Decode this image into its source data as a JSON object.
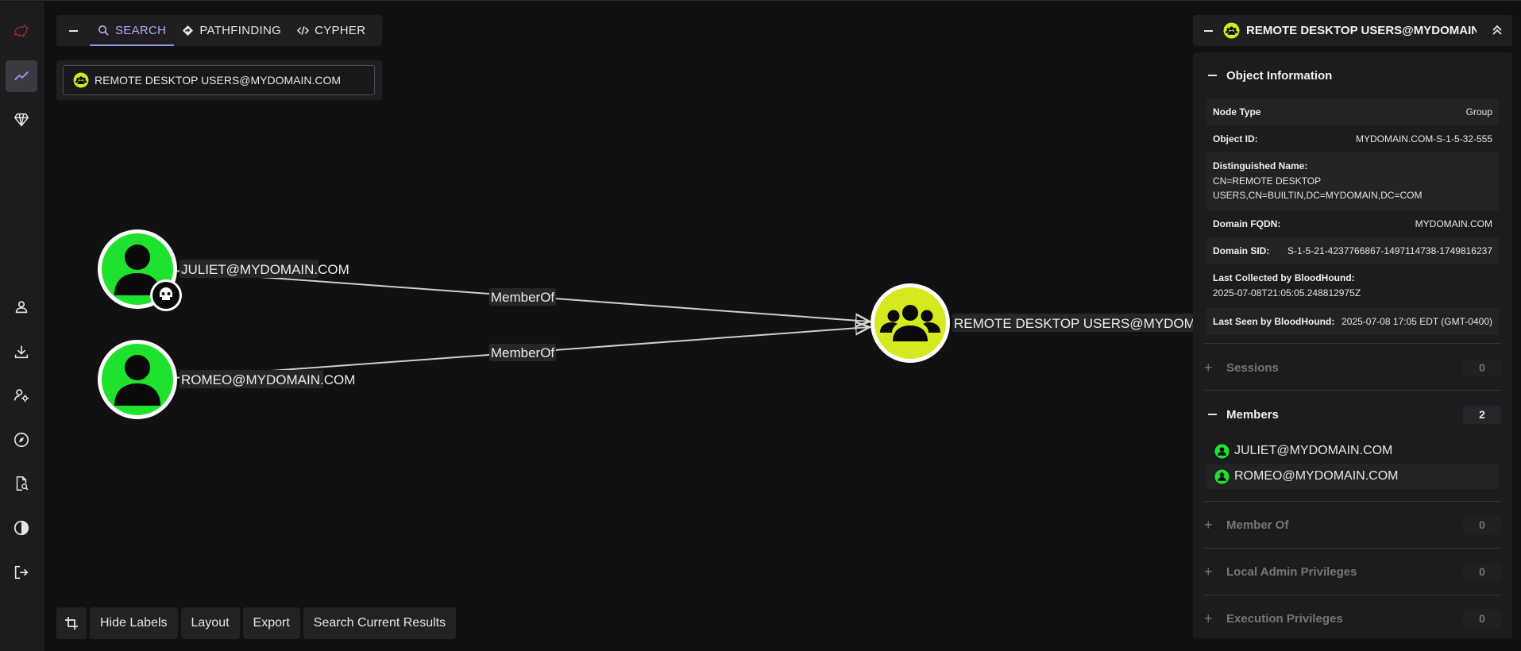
{
  "search_panel": {
    "tabs": [
      {
        "label": "SEARCH",
        "icon": "search-icon"
      },
      {
        "label": "PATHFINDING",
        "icon": "pathfinding-icon"
      },
      {
        "label": "CYPHER",
        "icon": "code-icon"
      }
    ],
    "query": "REMOTE DESKTOP USERS@MYDOMAIN.COM"
  },
  "graph": {
    "nodes": [
      {
        "label": "JULIET@MYDOMAIN.COM",
        "kind": "user",
        "color": "#1fe22e",
        "badge": "skull-icon"
      },
      {
        "label": "ROMEO@MYDOMAIN.COM",
        "kind": "user",
        "color": "#1fe22e"
      },
      {
        "label": "REMOTE DESKTOP USERS@MYDOMAIN.COM",
        "kind": "group",
        "color": "#d6e81e"
      }
    ],
    "edges": [
      {
        "label": "MemberOf"
      },
      {
        "label": "MemberOf"
      }
    ]
  },
  "bottom_toolbar": {
    "hide_labels": "Hide Labels",
    "layout": "Layout",
    "export": "Export",
    "search_results": "Search Current Results"
  },
  "entity_panel": {
    "title": "REMOTE DESKTOP USERS@MYDOMAIN....",
    "object_info": {
      "heading": "Object Information",
      "props": [
        {
          "key": "Node Type",
          "value": "Group"
        },
        {
          "key": "Object ID:",
          "value": "MYDOMAIN.COM-S-1-5-32-555"
        },
        {
          "key": "Distinguished Name:",
          "value": "CN=REMOTE DESKTOP USERS,CN=BUILTIN,DC=MYDOMAIN,DC=COM"
        },
        {
          "key": "Domain FQDN:",
          "value": "MYDOMAIN.COM"
        },
        {
          "key": "Domain SID:",
          "value": "S-1-5-21-4237766867-1497114738-1749816237"
        },
        {
          "key": "Last Collected by BloodHound:",
          "value": "2025-07-08T21:05:05.248812975Z"
        },
        {
          "key": "Last Seen by BloodHound:",
          "value": "2025-07-08 17:05 EDT (GMT-0400)"
        }
      ]
    },
    "sections": {
      "sessions": {
        "label": "Sessions",
        "count": "0"
      },
      "members": {
        "label": "Members",
        "count": "2",
        "items": [
          "JULIET@MYDOMAIN.COM",
          "ROMEO@MYDOMAIN.COM"
        ]
      },
      "member_of": {
        "label": "Member Of",
        "count": "0"
      },
      "local_admin": {
        "label": "Local Admin Privileges",
        "count": "0"
      },
      "execution": {
        "label": "Execution Privileges",
        "count": "0"
      }
    }
  },
  "colors": {
    "user_node": "#1fe22e",
    "group_node": "#d6e81e",
    "accent": "#8f98ee",
    "logo": "#b3242a"
  }
}
